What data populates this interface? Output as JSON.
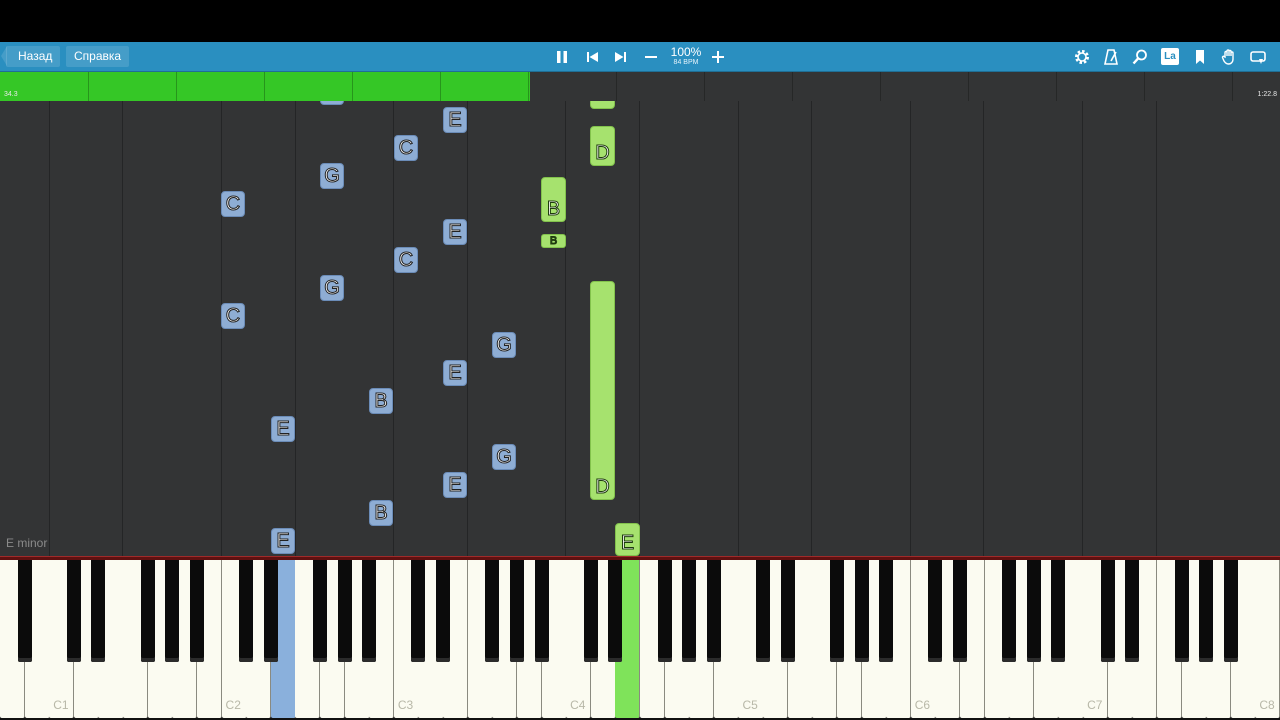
{
  "toolbar": {
    "back_label": "Назад",
    "help_label": "Справка",
    "zoom": "100%",
    "bpm": "84 BPM",
    "la_label": "La",
    "icons": [
      "pause-icon",
      "previous-icon",
      "next-icon",
      "minus-icon",
      "plus-icon",
      "gear-icon",
      "metronome-icon",
      "search-icon",
      "la-icon",
      "bookmark-icon",
      "hand-icon",
      "loop-icon"
    ]
  },
  "timeline": {
    "current_time": "34.3",
    "total_time": "1:22.8",
    "progress_fraction": 0.414
  },
  "key_signature": "E minor",
  "notes": [
    {
      "label": "E",
      "color": "blue"
    },
    {
      "label": "C",
      "color": "blue"
    },
    {
      "label": "G",
      "color": "blue"
    },
    {
      "label": "C",
      "color": "blue"
    },
    {
      "label": "E",
      "color": "blue"
    },
    {
      "label": "C",
      "color": "blue"
    },
    {
      "label": "G",
      "color": "blue"
    },
    {
      "label": "C",
      "color": "blue"
    },
    {
      "label": "G",
      "color": "blue"
    },
    {
      "label": "E",
      "color": "blue"
    },
    {
      "label": "B",
      "color": "blue"
    },
    {
      "label": "E",
      "color": "blue"
    },
    {
      "label": "G",
      "color": "blue"
    },
    {
      "label": "E",
      "color": "blue"
    },
    {
      "label": "B",
      "color": "blue"
    },
    {
      "label": "E",
      "color": "blue"
    },
    {
      "label": "D",
      "color": "green"
    },
    {
      "label": "B",
      "color": "green"
    },
    {
      "label": "B",
      "color": "green"
    },
    {
      "label": "D",
      "color": "green"
    },
    {
      "label": "E",
      "color": "green"
    }
  ],
  "keyboard": {
    "octave_labels": [
      "C1",
      "C2",
      "C3",
      "C4",
      "C5",
      "C6",
      "C7",
      "C8"
    ]
  },
  "colors": {
    "toolbar": "#2a8fc0",
    "progress": "#35c726",
    "note_blue": "#8eadd4",
    "note_green": "#a6e26e",
    "pressed_blue": "#8ab0dc",
    "pressed_green": "#7fe35a"
  }
}
